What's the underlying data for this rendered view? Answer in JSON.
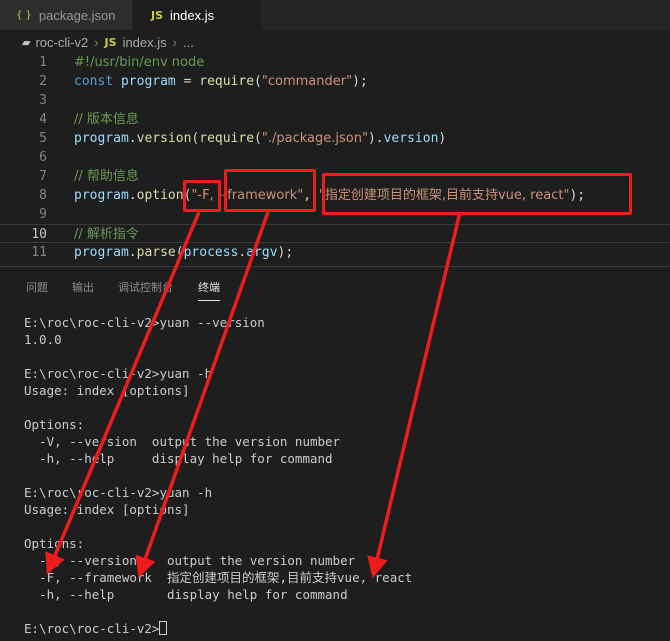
{
  "tabs": [
    {
      "label": "package.json",
      "icon": "json-file-icon"
    },
    {
      "label": "index.js",
      "icon": "js-file-icon"
    }
  ],
  "breadcrumb": {
    "folder": "roc-cli-v2",
    "file": "index.js",
    "more": "..."
  },
  "editor": {
    "lines": [
      {
        "num": "1",
        "text": "#!/usr/bin/env node"
      },
      {
        "num": "2",
        "text": "const program = require(\"commander\");"
      },
      {
        "num": "3",
        "text": ""
      },
      {
        "num": "4",
        "text": "// 版本信息"
      },
      {
        "num": "5",
        "text": "program.version(require(\"./package.json\").version)"
      },
      {
        "num": "6",
        "text": ""
      },
      {
        "num": "7",
        "text": "// 帮助信息"
      },
      {
        "num": "8",
        "text": "program.option(\"-F, --framework\", \"指定创建项目的框架,目前支持vue, react\");"
      },
      {
        "num": "9",
        "text": ""
      },
      {
        "num": "10",
        "text": "// 解析指令"
      },
      {
        "num": "11",
        "text": "program.parse(process.argv);"
      }
    ],
    "current_line": "10"
  },
  "panel": {
    "tabs": [
      {
        "label": "问题",
        "active": false
      },
      {
        "label": "输出",
        "active": false
      },
      {
        "label": "调试控制台",
        "active": false
      },
      {
        "label": "终端",
        "active": true
      }
    ]
  },
  "terminal": {
    "lines": [
      "E:\\roc\\roc-cli-v2>yuan --version",
      "1.0.0",
      "",
      "E:\\roc\\roc-cli-v2>yuan -h",
      "Usage: index [options]",
      "",
      "Options:",
      "  -V, --version  output the version number",
      "  -h, --help     display help for command",
      "",
      "E:\\roc\\roc-cli-v2>yuan -h",
      "Usage: index [options]",
      "",
      "Options:",
      "  -V, --version    output the version number",
      "  -F, --framework  指定创建项目的框架,目前支持vue, react",
      "  -h, --help       display help for command",
      "",
      "E:\\roc\\roc-cli-v2>"
    ]
  },
  "colors": {
    "annotation": "#ee1c1c",
    "background": "#1e1e1e"
  }
}
